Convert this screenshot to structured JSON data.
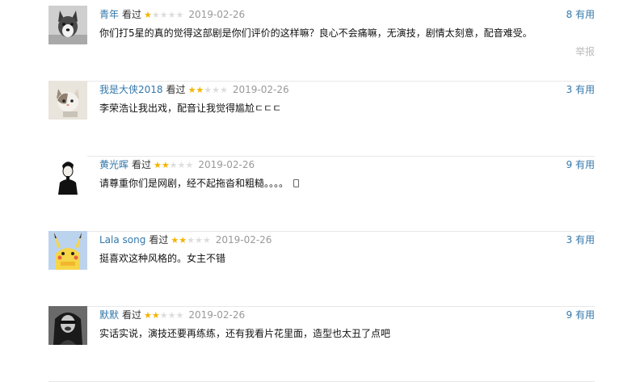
{
  "reviews": [
    {
      "user": "青年",
      "watched": "看过",
      "rating": 1,
      "time": "2019-02-26",
      "votes": "8 有用",
      "content": "你们打5星的真的觉得这部剧是你们评价的这样嘛？良心不会痛嘛，无演技，剧情太刻意，配音难受。",
      "report": "举报",
      "avatar_icon": "husky-dog-icon"
    },
    {
      "user": "我是大侠2018",
      "watched": "看过",
      "rating": 2,
      "time": "2019-02-26",
      "votes": "3 有用",
      "content": "李荣浩让我出戏，配音让我觉得尴尬ㄷㄷㄷ",
      "avatar_icon": "cat-icon"
    },
    {
      "user": "黄光晖",
      "watched": "看过",
      "rating": 2,
      "time": "2019-02-26",
      "votes": "9 有用",
      "content": "请尊重你们是网剧，经不起拖沓和粗糙。。。。",
      "avatar_icon": "man-silhouette-icon"
    },
    {
      "user": "Lala song",
      "watched": "看过",
      "rating": 2,
      "time": "2019-02-26",
      "votes": "3 有用",
      "content": "挺喜欢这种风格的。女主不错",
      "avatar_icon": "pikachu-icon"
    },
    {
      "user": "默默",
      "watched": "看过",
      "rating": 2,
      "time": "2019-02-26",
      "votes": "9 有用",
      "content": "实话实说，演技还要再练练，还有我看片花里面，造型也太丑了点吧",
      "avatar_icon": "mona-lisa-icon"
    }
  ],
  "colors": {
    "link": "#3377aa",
    "star_on": "#f5b400",
    "star_off": "#dddddd",
    "meta_gray": "#999999"
  }
}
